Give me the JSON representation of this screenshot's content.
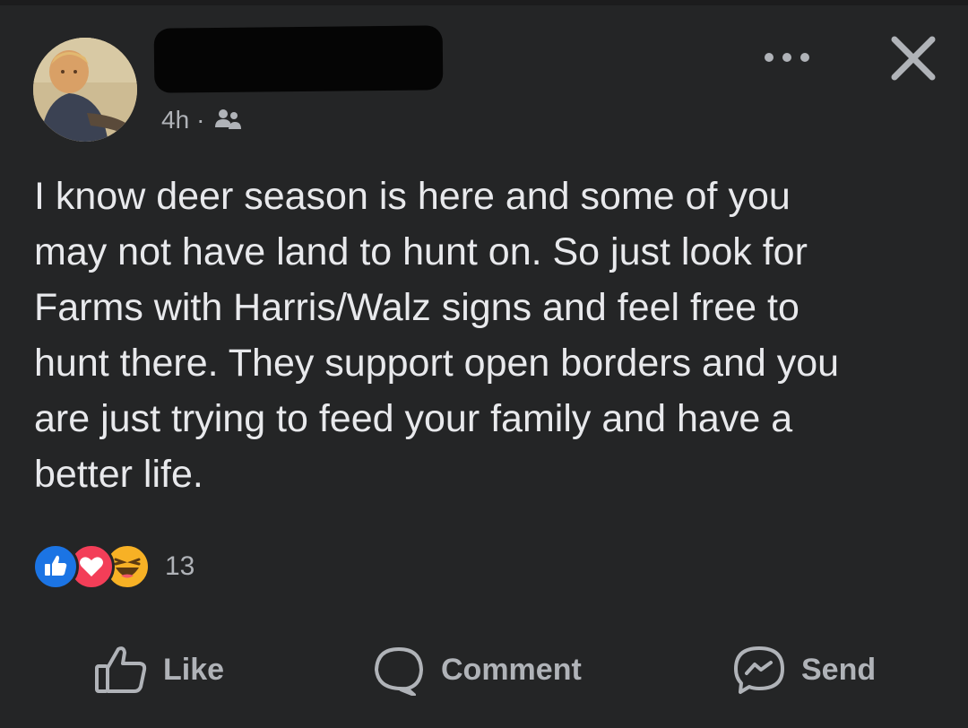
{
  "post": {
    "author_name": "",
    "timestamp": "4h",
    "separator": "·",
    "audience_icon": "friends-icon",
    "text": "I know deer season is here and some of you\nmay not have land to hunt on. So just look for\nFarms with Harris/Walz signs and feel free to\nhunt there. They support open borders and you\nare just trying to feed your family and have a\nbetter life."
  },
  "header_icons": {
    "more": "more-options-icon",
    "close": "close-icon"
  },
  "reactions": {
    "types": [
      "like",
      "love",
      "haha"
    ],
    "count": "13"
  },
  "actions": {
    "like_label": "Like",
    "comment_label": "Comment",
    "send_label": "Send"
  },
  "colors": {
    "background": "#242526",
    "text": "#e4e6eb",
    "secondary_text": "#b0b3b8",
    "like_blue": "#1b74e4",
    "love_red": "#f33e58",
    "haha_yellow": "#f7b125"
  }
}
